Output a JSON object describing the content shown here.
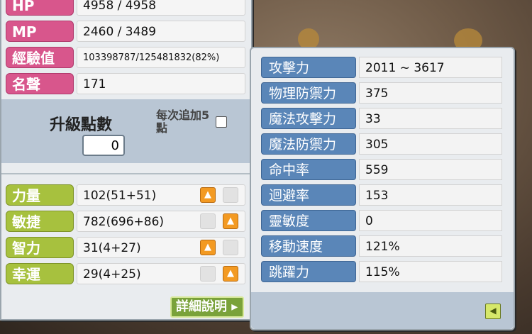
{
  "basic_stats": [
    {
      "label": "HP",
      "value": "4958 / 4958"
    },
    {
      "label": "MP",
      "value": "2460 / 3489"
    },
    {
      "label": "經驗值",
      "value": "103398787/125481832(82%)"
    },
    {
      "label": "名聲",
      "value": "171"
    }
  ],
  "ability_points": {
    "label": "升級點數",
    "value": "0",
    "auto_add_label": "每次追加5點",
    "auto_add_checked": false
  },
  "main_stats": [
    {
      "label": "力量",
      "value": "102(51+51)",
      "up_enabled": true
    },
    {
      "label": "敏捷",
      "value": "782(696+86)",
      "up_enabled": true
    },
    {
      "label": "智力",
      "value": "31(4+27)",
      "up_enabled": true
    },
    {
      "label": "幸運",
      "value": "29(4+25)",
      "up_enabled": true
    }
  ],
  "detail_button_label": "詳細說明",
  "detail_stats": [
    {
      "label": "攻擊力",
      "value": "2011 ~ 3617"
    },
    {
      "label": "物理防禦力",
      "value": "375"
    },
    {
      "label": "魔法攻擊力",
      "value": "33"
    },
    {
      "label": "魔法防禦力",
      "value": "305"
    },
    {
      "label": "命中率",
      "value": "559"
    },
    {
      "label": "迴避率",
      "value": "153"
    },
    {
      "label": "靈敏度",
      "value": "0"
    },
    {
      "label": "移動速度",
      "value": "121%"
    },
    {
      "label": "跳躍力",
      "value": "115%"
    }
  ],
  "colors": {
    "pink_tag": "#d8568c",
    "green_tag": "#a7c13e",
    "blue_tag": "#5a86b8",
    "up_button": "#f39a22"
  },
  "icons": {
    "up": "arrow-up-icon",
    "close": "arrow-left-icon"
  }
}
